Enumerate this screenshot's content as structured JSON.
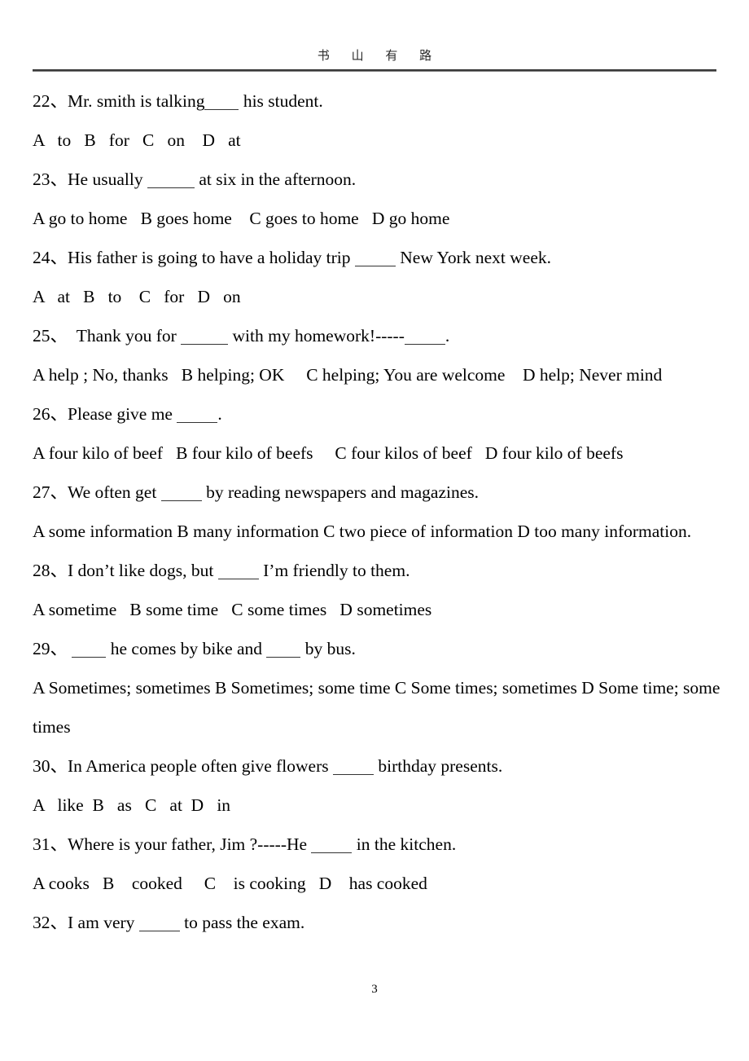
{
  "header": {
    "title": "书 山 有 路"
  },
  "footer": {
    "page_number": "3"
  },
  "questions": [
    {
      "number": "22、",
      "stem_before": "Mr. smith is talking",
      "stem_after": " his student.",
      "blank": "w-short",
      "options": "A   to   B   for   C   on    D   at"
    },
    {
      "number": "23、",
      "stem_before": "He usually ",
      "stem_after": " at six in the afternoon.",
      "blank": "w-long",
      "options": "A go to home   B goes home    C goes to home   D go home"
    },
    {
      "number": "24、",
      "stem_before": "His father is going to have a holiday trip ",
      "stem_after": " New York next week.",
      "blank": "w-mid",
      "options": "A   at   B   to    C   for   D   on"
    },
    {
      "number": "25、",
      "stem_before": "  Thank you for ",
      "stem_mid": " with my homework!-----",
      "stem_after": ".",
      "blank": "w-long",
      "blank2": "w-mid",
      "options": "A help ; No, thanks   B helping; OK     C helping; You are welcome    D help; Never mind"
    },
    {
      "number": "26、",
      "stem_before": "Please give me ",
      "stem_after": ".",
      "blank": "w-mid",
      "options": "A four kilo of beef   B four kilo of beefs     C four kilos of beef   D four kilo of beefs"
    },
    {
      "number": "27、",
      "stem_before": "We often get ",
      "stem_after": " by reading newspapers and magazines.",
      "blank": "w-mid",
      "options": "A  some  information    B  many  information      C  two  piece  of  information    D    too  many  information."
    },
    {
      "number": "28、",
      "stem_before": "I don’t like dogs, but ",
      "stem_after": " I’m friendly to them.",
      "blank": "w-mid",
      "options": "A sometime   B some time   C some times   D sometimes"
    },
    {
      "number": "29、",
      "stem_before": " ",
      "stem_mid": " he comes by bike and ",
      "stem_after": " by bus.",
      "blank": "w-short",
      "blank2": "w-short",
      "options": "A Sometimes; sometimes   B Sometimes; some time     C Some times; sometimes    D Some time; some times"
    },
    {
      "number": "30、",
      "stem_before": "In America people often give flowers ",
      "stem_after": " birthday presents.",
      "blank": "w-mid",
      "options": "A   like  B   as   C   at  D   in"
    },
    {
      "number": "31、",
      "stem_before": "Where is your father, Jim ?-----He ",
      "stem_after": " in the kitchen.",
      "blank": "w-mid",
      "options": "A cooks   B    cooked     C    is cooking   D    has cooked"
    },
    {
      "number": "32、",
      "stem_before": "I am very ",
      "stem_after": " to pass the exam.",
      "blank": "w-mid",
      "options": ""
    }
  ]
}
